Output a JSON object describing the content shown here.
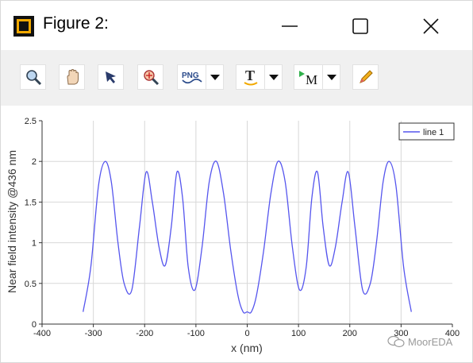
{
  "window": {
    "title": "Figure 2:"
  },
  "toolbar": {
    "buttons": [
      {
        "name": "zoom-button",
        "icon": "magnifier-icon"
      },
      {
        "name": "pan-button",
        "icon": "hand-icon"
      },
      {
        "name": "select-button",
        "icon": "arrow-cursor-icon"
      },
      {
        "name": "reset-zoom-button",
        "icon": "zoom-reset-icon"
      },
      {
        "name": "export-png-button",
        "icon": "png-icon",
        "label": "PNG"
      },
      {
        "name": "text-button",
        "icon": "text-icon",
        "label": "T"
      },
      {
        "name": "marker-button",
        "icon": "marker-icon",
        "label": "M"
      },
      {
        "name": "edit-button",
        "icon": "pencil-icon"
      }
    ]
  },
  "chart_data": {
    "type": "line",
    "title": "",
    "xlabel": "x (nm)",
    "ylabel": "Near field intensity @436 nm",
    "xlim": [
      -400,
      400
    ],
    "ylim": [
      0,
      2.5
    ],
    "xticks": [
      "-400",
      "-300",
      "-200",
      "-100",
      "0",
      "100",
      "200",
      "300",
      "400"
    ],
    "yticks": [
      "0",
      "0.5",
      "1",
      "1.5",
      "2",
      "2.5"
    ],
    "grid": true,
    "legend_position": "top-right",
    "series": [
      {
        "name": "line 1",
        "color": "#5555ee",
        "x": [
          -320,
          -305,
          -290,
          -277,
          -265,
          -252,
          -240,
          -225,
          -210,
          -197,
          -185,
          -172,
          -160,
          -148,
          -137,
          -126,
          -115,
          -102,
          -88,
          -74,
          -60,
          -46,
          -32,
          -18,
          -8,
          0,
          8,
          18,
          32,
          46,
          60,
          74,
          88,
          102,
          115,
          126,
          137,
          148,
          160,
          172,
          185,
          197,
          210,
          225,
          240,
          252,
          265,
          277,
          290,
          305,
          320
        ],
        "y": [
          0.15,
          0.7,
          1.7,
          2.0,
          1.75,
          1.0,
          0.5,
          0.42,
          1.2,
          1.87,
          1.5,
          0.95,
          0.72,
          1.2,
          1.87,
          1.55,
          0.7,
          0.42,
          0.95,
          1.75,
          2.0,
          1.6,
          0.9,
          0.35,
          0.15,
          0.15,
          0.15,
          0.35,
          0.9,
          1.6,
          2.0,
          1.75,
          0.95,
          0.42,
          0.7,
          1.55,
          1.87,
          1.2,
          0.72,
          0.95,
          1.5,
          1.87,
          1.2,
          0.42,
          0.5,
          1.0,
          1.75,
          2.0,
          1.7,
          0.7,
          0.15
        ]
      }
    ]
  },
  "watermark": {
    "text": "MoorEDA"
  }
}
